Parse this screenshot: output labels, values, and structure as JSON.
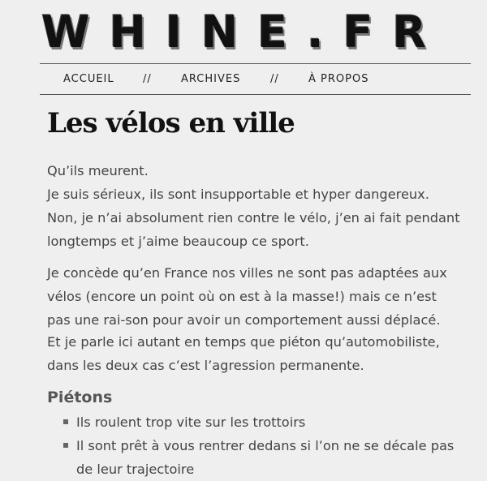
{
  "site": {
    "logo": "WHINE.FR"
  },
  "nav": {
    "items": [
      "ACCUEIL",
      "ARCHIVES",
      "À PROPOS"
    ],
    "separator": "//"
  },
  "article": {
    "title": "Les vélos en ville",
    "paragraphs": [
      "Qu’ils meurent.",
      "Je suis sérieux, ils sont insupportable et hyper dangereux. Non, je n’ai absolument rien contre le vélo, j’en ai fait pendant longtemps et j’aime beaucoup ce sport.",
      "Je concède qu’en France nos villes ne sont pas adaptées aux vélos (encore un point où on est à la masse!) mais ce n’est pas une rai-son pour avoir un comportement aussi déplacé.",
      "Et je parle ici autant en temps que piéton qu’automobiliste, dans les deux cas c’est l’agression permanente."
    ],
    "section_title": "Piétons",
    "list_items": [
      "Ils roulent trop vite sur les trottoirs",
      "Il sont prêt à vous rentrer dedans si l’on ne se décale pas de leur trajectoire"
    ]
  }
}
